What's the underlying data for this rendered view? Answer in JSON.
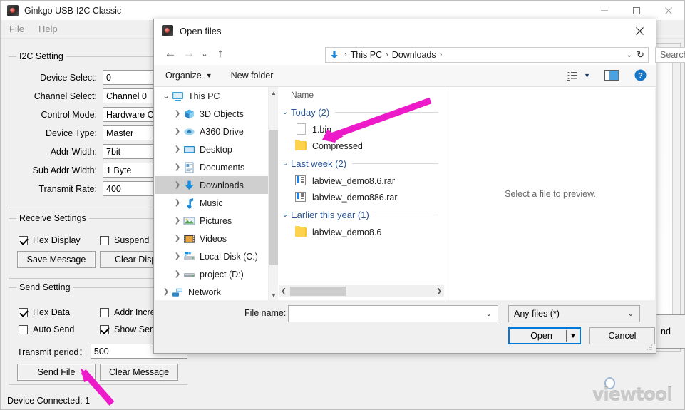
{
  "app": {
    "title": "Ginkgo USB-I2C Classic",
    "icon": "app-chip-icon",
    "menu": [
      "File",
      "Help"
    ],
    "window_buttons": [
      "minimize",
      "maximize",
      "close"
    ],
    "status": "Device Connected: 1",
    "watermark": "viewtool",
    "partial_button_label": "nd"
  },
  "i2c_setting": {
    "legend": "I2C Setting",
    "fields": [
      {
        "label": "Device Select:",
        "value": "0"
      },
      {
        "label": "Channel Select:",
        "value": "Channel 0"
      },
      {
        "label": "Control Mode:",
        "value": "Hardware Cont"
      },
      {
        "label": "Device Type:",
        "value": "Master"
      },
      {
        "label": "Addr Width:",
        "value": "7bit"
      },
      {
        "label": "Sub Addr Width:",
        "value": "1 Byte"
      },
      {
        "label": "Transmit Rate:",
        "value": "400"
      }
    ]
  },
  "receive_settings": {
    "legend": "Receive Settings",
    "checkboxes": [
      {
        "label": "Hex Display",
        "checked": true
      },
      {
        "label": "Suspend",
        "checked": false
      }
    ],
    "buttons": [
      "Save Message",
      "Clear Displa"
    ]
  },
  "send_setting": {
    "legend": "Send Setting",
    "checkboxes": [
      {
        "label": "Hex Data",
        "checked": true
      },
      {
        "label": "Addr Increm",
        "checked": false
      },
      {
        "label": "Auto Send",
        "checked": false
      },
      {
        "label": "Show Send D",
        "checked": true
      }
    ],
    "period_label": "Transmit period：",
    "period_value": "500",
    "buttons": [
      "Send File",
      "Clear Message"
    ]
  },
  "dialog": {
    "title": "Open files",
    "icon": "app-chip-icon",
    "close_label": "close-icon",
    "nav": {
      "back": "back-arrow-icon",
      "forward": "forward-arrow-icon",
      "recent": "recent-chevron-icon",
      "up": "up-arrow-icon"
    },
    "address": {
      "icon": "downloads-arrow-icon",
      "crumbs": [
        "This PC",
        "Downloads"
      ],
      "separator": "›",
      "dropdown": "chevron-down-icon",
      "refresh": "refresh-icon"
    },
    "search": {
      "placeholder": "Search Downloads",
      "value": "",
      "icon": "search-icon"
    },
    "toolbar": {
      "organize": "Organize",
      "new_folder": "New folder",
      "view_icon": "view-list-icon",
      "pane_icon": "preview-pane-icon",
      "help_icon": "help-icon"
    },
    "tree": {
      "items": [
        {
          "label": "This PC",
          "indent": 0,
          "expanded": true,
          "icon": "monitor-icon",
          "selected": false
        },
        {
          "label": "3D Objects",
          "indent": 1,
          "expanded": false,
          "icon": "3d-objects-icon",
          "selected": false
        },
        {
          "label": "A360 Drive",
          "indent": 1,
          "expanded": false,
          "icon": "a360-icon",
          "selected": false
        },
        {
          "label": "Desktop",
          "indent": 1,
          "expanded": false,
          "icon": "desktop-icon",
          "selected": false
        },
        {
          "label": "Documents",
          "indent": 1,
          "expanded": false,
          "icon": "documents-icon",
          "selected": false
        },
        {
          "label": "Downloads",
          "indent": 1,
          "expanded": false,
          "icon": "downloads-icon",
          "selected": true
        },
        {
          "label": "Music",
          "indent": 1,
          "expanded": false,
          "icon": "music-icon",
          "selected": false
        },
        {
          "label": "Pictures",
          "indent": 1,
          "expanded": false,
          "icon": "pictures-icon",
          "selected": false
        },
        {
          "label": "Videos",
          "indent": 1,
          "expanded": false,
          "icon": "videos-icon",
          "selected": false
        },
        {
          "label": "Local Disk (C:)",
          "indent": 1,
          "expanded": false,
          "icon": "disk-c-icon",
          "selected": false
        },
        {
          "label": "project (D:)",
          "indent": 1,
          "expanded": false,
          "icon": "disk-d-icon",
          "selected": false
        },
        {
          "label": "Network",
          "indent": 0,
          "expanded": false,
          "icon": "network-icon",
          "selected": false
        }
      ]
    },
    "file_list": {
      "column_header": "Name",
      "groups": [
        {
          "title": "Today (2)",
          "files": [
            {
              "name": "1.bin",
              "icon": "file-generic-icon"
            },
            {
              "name": "Compressed",
              "icon": "folder-icon"
            }
          ]
        },
        {
          "title": "Last week (2)",
          "files": [
            {
              "name": "labview_demo8.6.rar",
              "icon": "archive-icon"
            },
            {
              "name": "labview_demo886.rar",
              "icon": "archive-icon"
            }
          ]
        },
        {
          "title": "Earlier this year (1)",
          "files": [
            {
              "name": "labview_demo8.6",
              "icon": "folder-icon"
            }
          ]
        }
      ]
    },
    "preview": {
      "message": "Select a file to preview."
    },
    "footer": {
      "file_name_label": "File name:",
      "file_name_value": "",
      "filter_value": "Any files (*)",
      "open_label": "Open",
      "cancel_label": "Cancel"
    }
  },
  "annotations": {
    "arrow_color": "#ec1ac8",
    "arrows": [
      {
        "name": "arrow-to-1bin",
        "points_to": "1.bin"
      },
      {
        "name": "arrow-to-send-file",
        "points_to": "Send File"
      }
    ]
  }
}
